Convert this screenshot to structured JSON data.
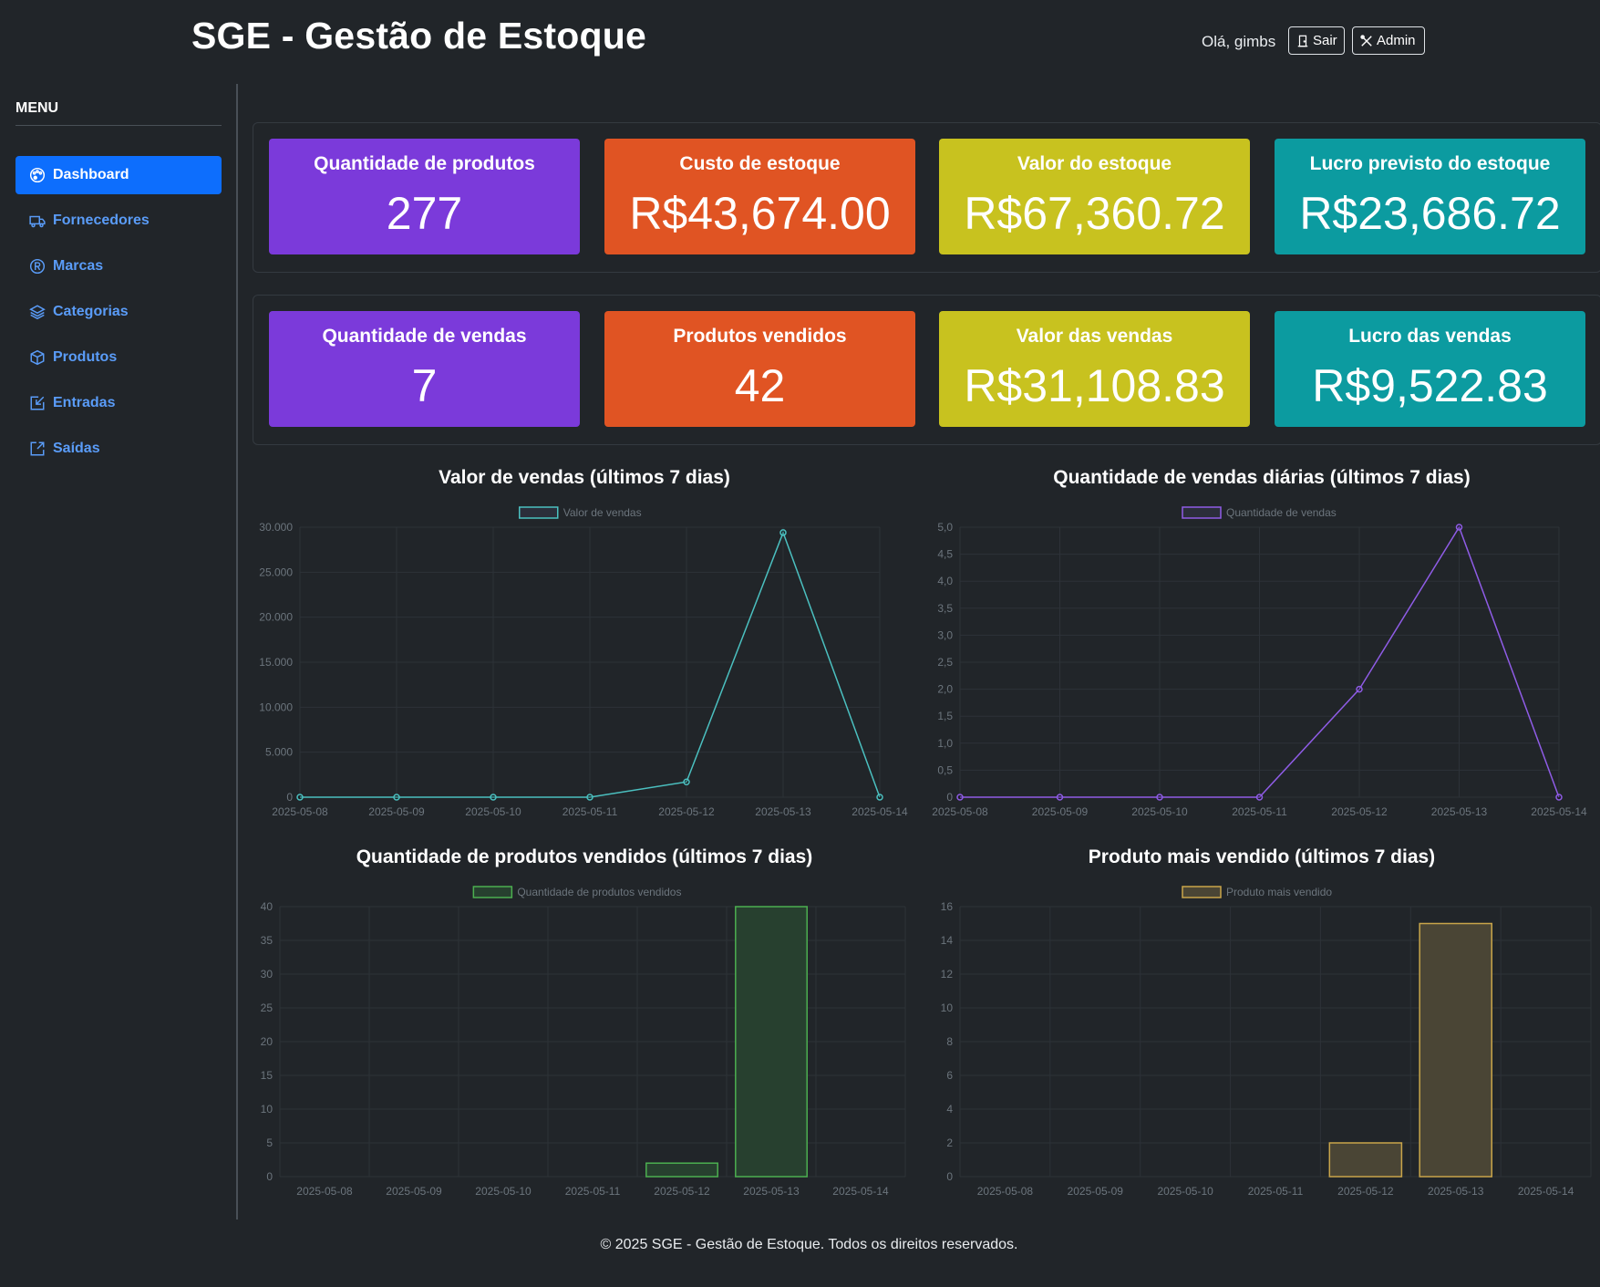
{
  "header": {
    "title": "SGE - Gestão de Estoque",
    "greeting": "Olá, gimbs",
    "logout_label": "Sair",
    "admin_label": "Admin"
  },
  "sidebar": {
    "menu_title": "MENU",
    "items": [
      {
        "label": "Dashboard",
        "icon": "palette-icon",
        "active": true
      },
      {
        "label": "Fornecedores",
        "icon": "truck-icon",
        "active": false
      },
      {
        "label": "Marcas",
        "icon": "registered-icon",
        "active": false
      },
      {
        "label": "Categorias",
        "icon": "layers-icon",
        "active": false
      },
      {
        "label": "Produtos",
        "icon": "box-icon",
        "active": false
      },
      {
        "label": "Entradas",
        "icon": "box-arrow-in-icon",
        "active": false
      },
      {
        "label": "Saídas",
        "icon": "box-arrow-out-icon",
        "active": false
      }
    ]
  },
  "metrics_stock": [
    {
      "title": "Quantidade de produtos",
      "value": "277",
      "color": "#7b3ada"
    },
    {
      "title": "Custo de estoque",
      "value": "R$43,674.00",
      "color": "#e05423"
    },
    {
      "title": "Valor do estoque",
      "value": "R$67,360.72",
      "color": "#c8c21f"
    },
    {
      "title": "Lucro previsto do estoque",
      "value": "R$23,686.72",
      "color": "#0c9ba0"
    }
  ],
  "metrics_sales": [
    {
      "title": "Quantidade de vendas",
      "value": "7",
      "color": "#7b3ada"
    },
    {
      "title": "Produtos vendidos",
      "value": "42",
      "color": "#e05423"
    },
    {
      "title": "Valor das vendas",
      "value": "R$31,108.83",
      "color": "#c8c21f"
    },
    {
      "title": "Lucro das vendas",
      "value": "R$9,522.83",
      "color": "#0c9ba0"
    }
  ],
  "chart_data": [
    {
      "type": "line",
      "title": "Valor de vendas (últimos 7 dias)",
      "categories": [
        "2025-05-08",
        "2025-05-09",
        "2025-05-10",
        "2025-05-11",
        "2025-05-12",
        "2025-05-13",
        "2025-05-14"
      ],
      "series": [
        {
          "name": "Valor de vendas",
          "values": [
            0,
            0,
            0,
            0,
            1700,
            29400,
            0
          ],
          "color": "#4bc0c0"
        }
      ],
      "yticks": [
        "0",
        "5.000",
        "10.000",
        "15.000",
        "20.000",
        "25.000",
        "30.000"
      ],
      "ylim": [
        0,
        30000
      ],
      "grid": true,
      "legend": "top"
    },
    {
      "type": "line",
      "title": "Quantidade de vendas diárias (últimos 7 dias)",
      "categories": [
        "2025-05-08",
        "2025-05-09",
        "2025-05-10",
        "2025-05-11",
        "2025-05-12",
        "2025-05-13",
        "2025-05-14"
      ],
      "series": [
        {
          "name": "Quantidade de vendas",
          "values": [
            0,
            0,
            0,
            0,
            2,
            5,
            0
          ],
          "color": "#8f5ce6"
        }
      ],
      "yticks": [
        "0",
        "0,5",
        "1,0",
        "1,5",
        "2,0",
        "2,5",
        "3,0",
        "3,5",
        "4,0",
        "4,5",
        "5,0"
      ],
      "ylim": [
        0,
        5
      ],
      "grid": true,
      "legend": "top"
    },
    {
      "type": "bar",
      "title": "Quantidade de produtos vendidos (últimos 7 dias)",
      "categories": [
        "2025-05-08",
        "2025-05-09",
        "2025-05-10",
        "2025-05-11",
        "2025-05-12",
        "2025-05-13",
        "2025-05-14"
      ],
      "series": [
        {
          "name": "Quantidade de produtos vendidos",
          "values": [
            0,
            0,
            0,
            0,
            2,
            40,
            0
          ],
          "color": "#4caf50",
          "fill": "#27402f"
        }
      ],
      "yticks": [
        "0",
        "5",
        "10",
        "15",
        "20",
        "25",
        "30",
        "35",
        "40"
      ],
      "ylim": [
        0,
        40
      ],
      "grid": true,
      "legend": "top"
    },
    {
      "type": "bar",
      "title": "Produto mais vendido (últimos 7 dias)",
      "categories": [
        "2025-05-08",
        "2025-05-09",
        "2025-05-10",
        "2025-05-11",
        "2025-05-12",
        "2025-05-13",
        "2025-05-14"
      ],
      "series": [
        {
          "name": "Produto mais vendido",
          "values": [
            0,
            0,
            0,
            0,
            2,
            15,
            0
          ],
          "color": "#c9a54a",
          "fill": "#4a4535"
        }
      ],
      "yticks": [
        "0",
        "2",
        "4",
        "6",
        "8",
        "10",
        "12",
        "14",
        "16"
      ],
      "ylim": [
        0,
        16
      ],
      "grid": true,
      "legend": "top"
    }
  ],
  "footer": "© 2025 SGE - Gestão de Estoque. Todos os direitos reservados."
}
